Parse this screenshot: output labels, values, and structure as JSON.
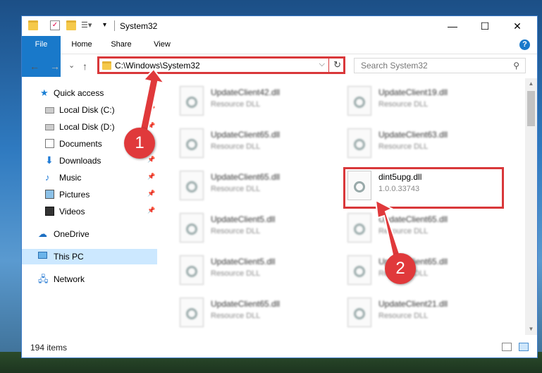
{
  "window": {
    "title": "System32",
    "minimize_glyph": "—",
    "maximize_glyph": "☐",
    "close_glyph": "✕"
  },
  "ribbon": {
    "file_tab": "File",
    "tabs": [
      "Home",
      "Share",
      "View"
    ],
    "help_glyph": "?"
  },
  "nav": {
    "back_glyph": "←",
    "forward_glyph": "→",
    "recent_glyph": "⌄",
    "up_glyph": "↑",
    "address": "C:\\Windows\\System32",
    "address_drop_glyph": "⌵",
    "refresh_glyph": "↻",
    "search_placeholder": "Search System32",
    "search_glyph": "⚲"
  },
  "sidebar": {
    "items": [
      {
        "label": "Quick access"
      },
      {
        "label": "Local Disk (C:)"
      },
      {
        "label": "Local Disk (D:)"
      },
      {
        "label": "Documents"
      },
      {
        "label": "Downloads"
      },
      {
        "label": "Music"
      },
      {
        "label": "Pictures"
      },
      {
        "label": "Videos"
      },
      {
        "label": "OneDrive"
      },
      {
        "label": "This PC"
      },
      {
        "label": "Network"
      }
    ]
  },
  "files": [
    {
      "name": "UpdateClient42.dll",
      "sub": "Resource DLL"
    },
    {
      "name": "UpdateClient19.dll",
      "sub": "Resource DLL"
    },
    {
      "name": "UpdateClient65.dll",
      "sub": "Resource DLL"
    },
    {
      "name": "UpdateClient63.dll",
      "sub": "Resource DLL"
    },
    {
      "name": "UpdateClient65.dll",
      "sub": "Resource DLL"
    },
    {
      "name": "dint5upg.dll",
      "sub": "1.0.0.33743"
    },
    {
      "name": "UpdateClient5.dll",
      "sub": "Resource DLL"
    },
    {
      "name": "UpdateClient65.dll",
      "sub": "Resource DLL"
    },
    {
      "name": "UpdateClient5.dll",
      "sub": "Resource DLL"
    },
    {
      "name": "UpdateClient65.dll",
      "sub": "Resource DLL"
    },
    {
      "name": "UpdateClient65.dll",
      "sub": "Resource DLL"
    },
    {
      "name": "UpdateClient21.dll",
      "sub": "Resource DLL"
    }
  ],
  "status": {
    "item_count": "194 items"
  },
  "markers": {
    "one": "1",
    "two": "2"
  },
  "colors": {
    "highlight": "#d9383a",
    "accent": "#1979ca",
    "selected": "#cce8ff"
  }
}
